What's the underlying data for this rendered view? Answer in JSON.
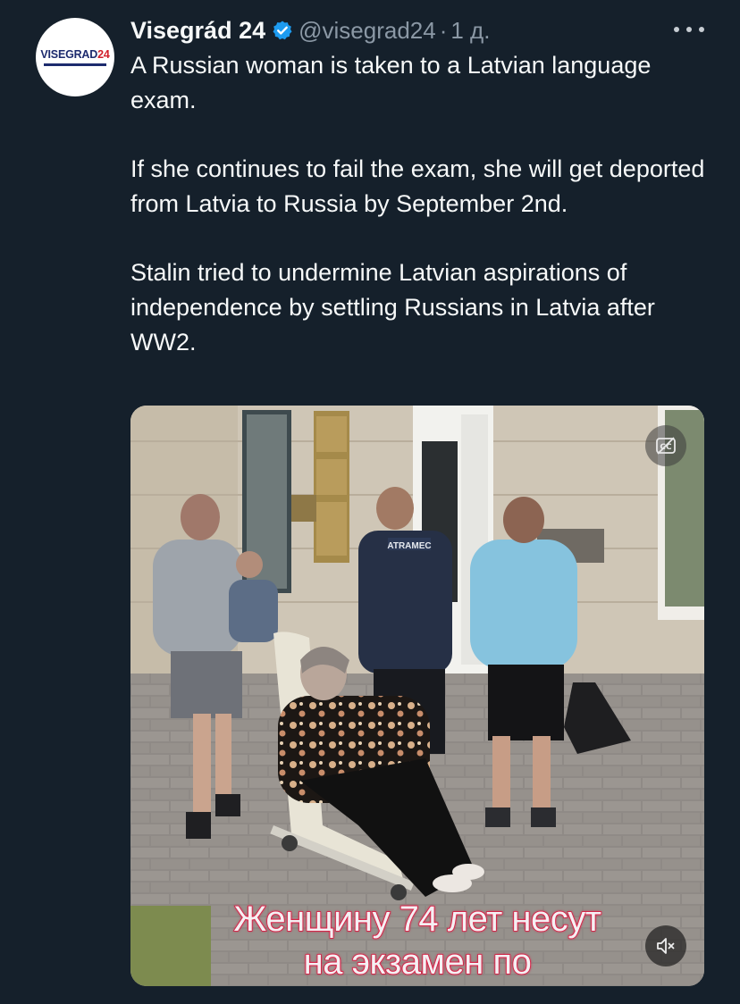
{
  "author": {
    "display_name": "Visegrád 24",
    "handle": "@visegrad24",
    "separator": "·",
    "timestamp": "1 д.",
    "avatar": {
      "wordmark_main": "VISEGRAD",
      "wordmark_accent": "24"
    }
  },
  "tweet": {
    "paragraphs": [
      "A Russian woman is taken to a Latvian language exam.",
      "If she continues to fail the exam, she will get deported from Latvia to Russia by September 2nd.",
      "Stalin tried to undermine Latvian aspirations of independence by settling Russians in Latvia after WW2."
    ]
  },
  "media": {
    "caption_lines": [
      "Женщину 74 лет несут",
      "на экзамен по"
    ],
    "placard_text": "ATRAMEC",
    "controls": {
      "captions_icon": "closed-captions-off-icon",
      "mute_icon": "volume-muted-icon"
    }
  },
  "colors": {
    "background": "#15202b",
    "text": "#f7f9f9",
    "secondary_text": "#8b98a5",
    "verified": "#1d9bf0",
    "caption_stroke": "#d21a3d"
  }
}
